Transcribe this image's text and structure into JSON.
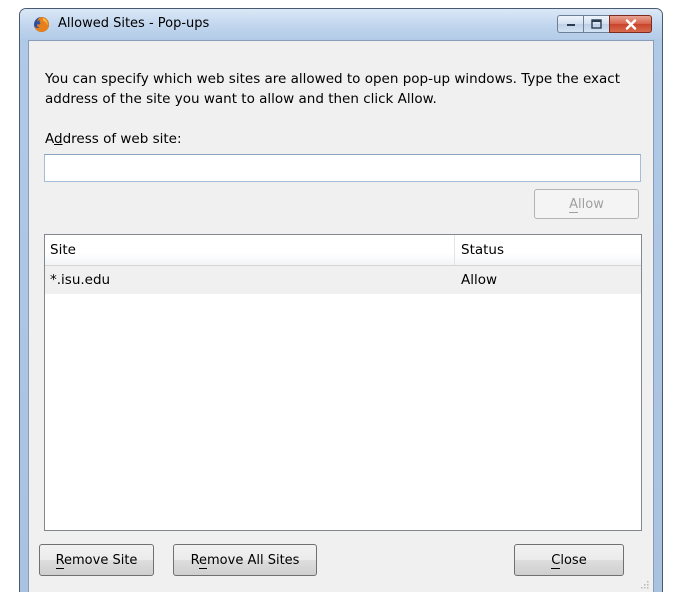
{
  "window": {
    "title": "Allowed Sites - Pop-ups",
    "icon": "firefox-icon",
    "controls": [
      "minimize-icon",
      "maximize-icon",
      "close-icon"
    ],
    "colors": {
      "titlebar": "#c1d6ee",
      "close_button": "#d7614a",
      "client_bg": "#f0f0f0"
    }
  },
  "dialog": {
    "description": "You can specify which web sites are allowed to open pop-up windows. Type the exact address of the site you want to allow and then click Allow.",
    "address_label": "Address of web site:",
    "address_label_access_key": "d",
    "address_value": "",
    "allow_button": {
      "label": "Allow",
      "disabled": true
    }
  },
  "sites_table": {
    "columns": [
      "Site",
      "Status"
    ],
    "rows": [
      {
        "site": "*.isu.edu",
        "status": "Allow",
        "selected": false
      }
    ]
  },
  "buttons": {
    "remove_site": "Remove Site",
    "remove_all_sites": "Remove All Sites",
    "close": "Close"
  }
}
